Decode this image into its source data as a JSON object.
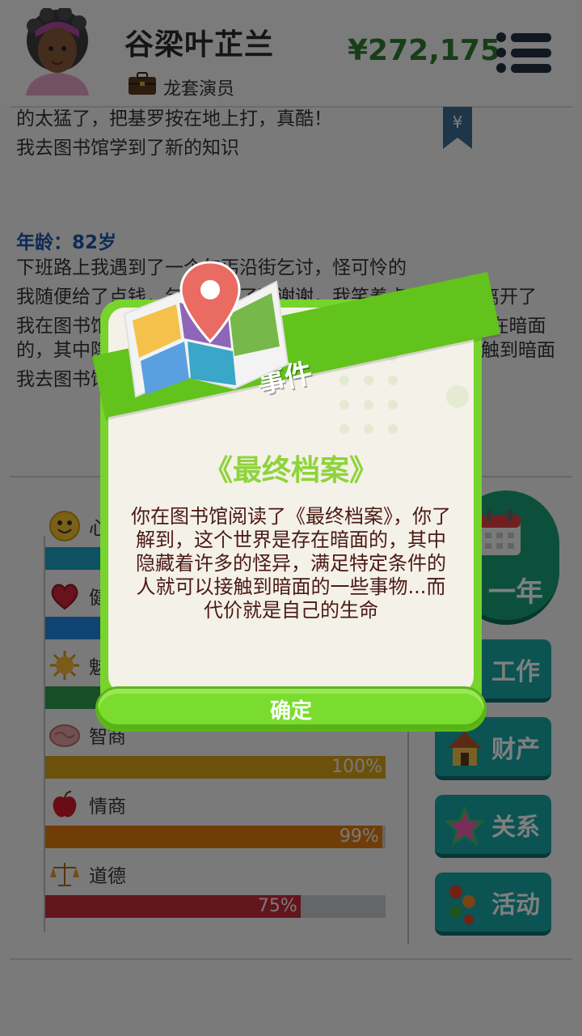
{
  "header": {
    "character_name": "谷梁叶芷兰",
    "job_title": "龙套演员",
    "money": "¥272,175",
    "bookmark_symbol": "¥"
  },
  "log": {
    "lines_top": [
      "的太猛了，把基罗按在地上打，真酷！",
      "我去图书馆学到了新的知识"
    ],
    "age_label": "年龄：82岁",
    "lines_bottom": [
      "下班路上我遇到了一个乞丐沿街乞讨，怪可怜的",
      "我随便给了点钱，乞丐连说了声谢谢，我笑着点点头然后离开了",
      "我在图书馆阅读了《最终档案》，你了解到，这个世界是存在暗面的，其中隐藏着许多的怪异，满足特定条件的人就可以接触到暗面",
      "我去图书馆学到了新的知识"
    ]
  },
  "stats": [
    {
      "name": "心情",
      "icon": "smiley-icon",
      "percent": 100,
      "color": "#1aa3c4",
      "value_text": ""
    },
    {
      "name": "健康",
      "icon": "heart-icon",
      "percent": 100,
      "color": "#1e88e5",
      "value_text": ""
    },
    {
      "name": "魅力",
      "icon": "sun-icon",
      "percent": 100,
      "color": "#2e9d4f",
      "value_text": ""
    },
    {
      "name": "智商",
      "icon": "brain-icon",
      "percent": 100,
      "color": "#d9a21b",
      "value_text": "100%"
    },
    {
      "name": "情商",
      "icon": "apple-icon",
      "percent": 99,
      "color": "#e07b12",
      "value_text": "99%"
    },
    {
      "name": "道德",
      "icon": "scales-icon",
      "percent": 75,
      "color": "#c62b3c",
      "value_text": "75%"
    }
  ],
  "actions": {
    "year_label": "一年",
    "work_label": "工作",
    "property_label": "财产",
    "relations_label": "关系",
    "activity_label": "活动"
  },
  "dialog": {
    "ribbon_label": "事件",
    "title": "《最终档案》",
    "body": "你在图书馆阅读了《最终档案》，你了解到，这个世界是存在暗面的，其中隐藏着许多的怪异，满足特定条件的人就可以接触到暗面的一些事物...而代价就是自己的生命",
    "confirm_label": "确定"
  }
}
